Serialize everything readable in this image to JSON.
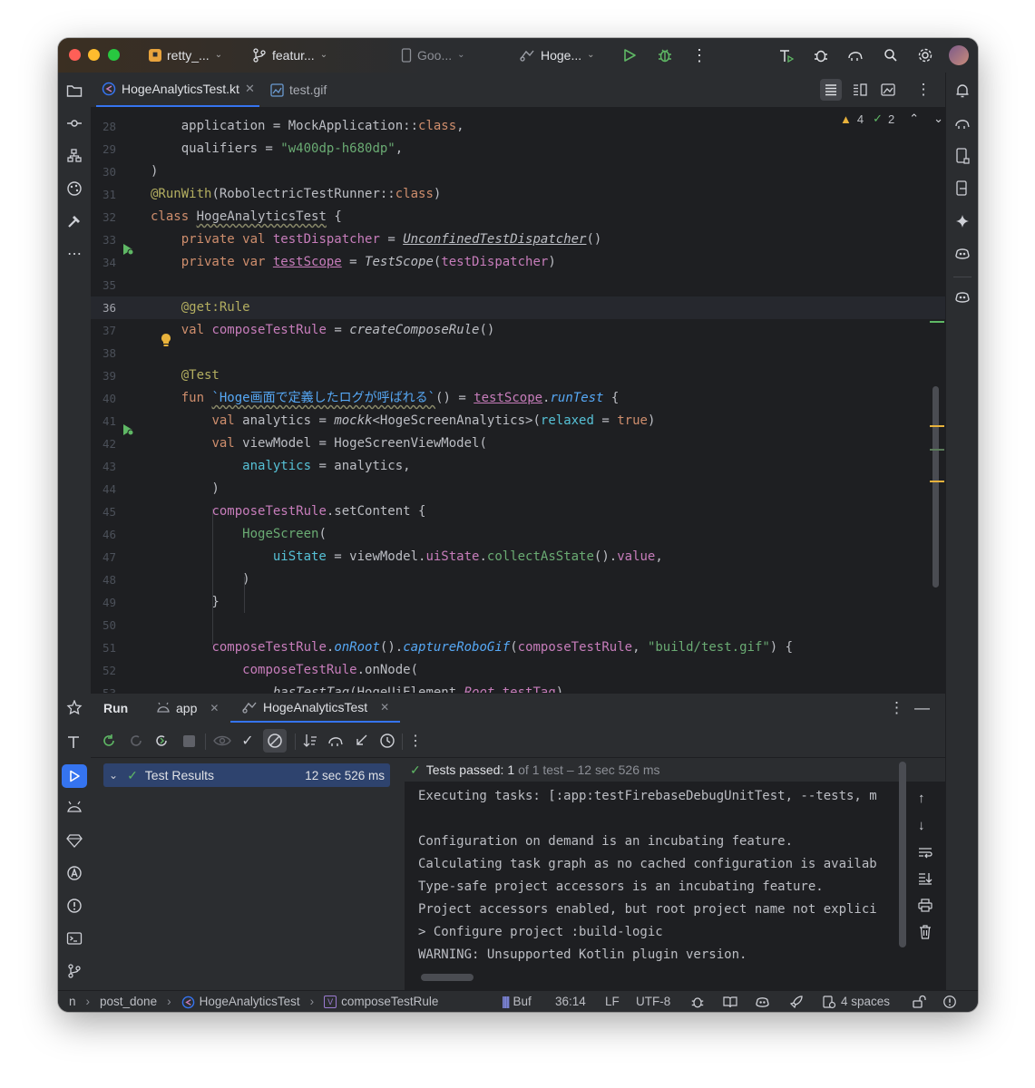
{
  "titlebar": {
    "project": "retty_...",
    "branch": "featur...",
    "device": "Goo...",
    "run_config": "Hoge..."
  },
  "tabs": [
    {
      "label": "HogeAnalyticsTest.kt",
      "active": true
    },
    {
      "label": "test.gif",
      "active": false
    }
  ],
  "inspections": {
    "warnings": "4",
    "ok": "2"
  },
  "editor": {
    "current_line": "36",
    "lines": [
      {
        "no": "28",
        "html": "    application = MockApplication::<span class=\"kw\">class</span>,"
      },
      {
        "no": "29",
        "html": "    qualifiers = <span class=\"str\">\"w400dp-h680dp\"</span>,"
      },
      {
        "no": "30",
        "html": ")"
      },
      {
        "no": "31",
        "html": "<span class=\"ann\">@RunWith</span>(RobolectricTestRunner::<span class=\"kw\">class</span>)"
      },
      {
        "no": "32",
        "html": "<span class=\"kw\">class</span> <span class=\"sq\">HogeAnalyticsTest</span> {"
      },
      {
        "no": "33",
        "html": "    <span class=\"kw\">private val</span> <span class=\"prop\">testDispatcher</span> = <span class=\"it ul\">UnconfinedTestDispatcher</span>()"
      },
      {
        "no": "34",
        "html": "    <span class=\"kw\">private var</span> <span class=\"prop ul\">testScope</span> = <span class=\"it\">TestScope</span>(<span class=\"prop\">testDispatcher</span>)"
      },
      {
        "no": "35",
        "html": ""
      },
      {
        "no": "36",
        "html": "    <span class=\"ann\">@get:</span><span class=\"ann\">Rule</span>"
      },
      {
        "no": "37",
        "html": "    <span class=\"kw\">val</span> <span class=\"prop\">composeTestRule</span> = <span class=\"it\">createComposeRule</span>()"
      },
      {
        "no": "38",
        "html": ""
      },
      {
        "no": "39",
        "html": "    <span class=\"ann\">@Test</span>"
      },
      {
        "no": "40",
        "html": "    <span class=\"kw\">fun</span> <span class=\"fn sq\">`Hoge画面で定義したログが呼ばれる`</span>() = <span class=\"prop ul\">testScope</span>.<span class=\"fn it\">runTest</span> {"
      },
      {
        "no": "41",
        "html": "        <span class=\"kw\">val</span> analytics = <span class=\"it\">mockk</span>&lt;HogeScreenAnalytics&gt;(<span class=\"param\">relaxed</span> = <span class=\"kw\">true</span>)"
      },
      {
        "no": "42",
        "html": "        <span class=\"kw\">val</span> viewModel = HogeScreenViewModel("
      },
      {
        "no": "43",
        "html": "            <span class=\"param\">analytics</span> = analytics,"
      },
      {
        "no": "44",
        "html": "        )"
      },
      {
        "no": "45",
        "html": "        <span class=\"prop\">composeTestRule</span>.setContent {"
      },
      {
        "no": "46",
        "html": "            <span class=\"green\">HogeScreen</span>("
      },
      {
        "no": "47",
        "html": "                <span class=\"param\">uiState</span> = viewModel.<span class=\"prop\">uiState</span>.<span class=\"green\">collectAsState</span>().<span class=\"prop\">value</span>,"
      },
      {
        "no": "48",
        "html": "            )"
      },
      {
        "no": "49",
        "html": "        }"
      },
      {
        "no": "50",
        "html": ""
      },
      {
        "no": "51",
        "html": "        <span class=\"prop\">composeTestRule</span>.<span class=\"fn it\">onRoot</span>().<span class=\"fn it\">captureRoboGif</span>(<span class=\"prop\">composeTestRule</span>, <span class=\"str\">\"build/test.gif\"</span>) {"
      },
      {
        "no": "52",
        "html": "            <span class=\"prop\">composeTestRule</span>.onNode("
      },
      {
        "no": "53",
        "html": "                <span class=\"it\">hasTestTag</span>(HogeUiElement.<span class=\"prop it\">Root</span>.<span class=\"prop\">testTag</span>),"
      }
    ]
  },
  "toolwindow": {
    "title": "Run",
    "tabs": [
      {
        "label": "app"
      },
      {
        "label": "HogeAnalyticsTest"
      }
    ],
    "tree": {
      "label": "Test Results",
      "time": "12 sec 526 ms"
    },
    "summary": {
      "prefix": "Tests passed:",
      "count": "1",
      "rest": "of 1 test – 12 sec 526 ms"
    },
    "console": [
      "Executing tasks: [:app:testFirebaseDebugUnitTest, --tests, m",
      "",
      "Configuration on demand is an incubating feature.",
      "Calculating task graph as no cached configuration is availab",
      "Type-safe project accessors is an incubating feature.",
      "Project accessors enabled, but root project name not explici",
      "> Configure project :build-logic",
      "WARNING: Unsupported Kotlin plugin version."
    ]
  },
  "statusbar": {
    "crumb1": "n",
    "crumb2": "post_done",
    "crumb3": "HogeAnalyticsTest",
    "crumb4": "composeTestRule",
    "buf": "Buf",
    "position": "36:14",
    "line_sep": "LF",
    "encoding": "UTF-8",
    "indent": "4 spaces"
  },
  "colors": {
    "accent": "#3574f0",
    "bg_editor": "#1e1f22",
    "bg_panel": "#2b2d30",
    "green": "#5fb865",
    "warning": "#e8b23c"
  }
}
